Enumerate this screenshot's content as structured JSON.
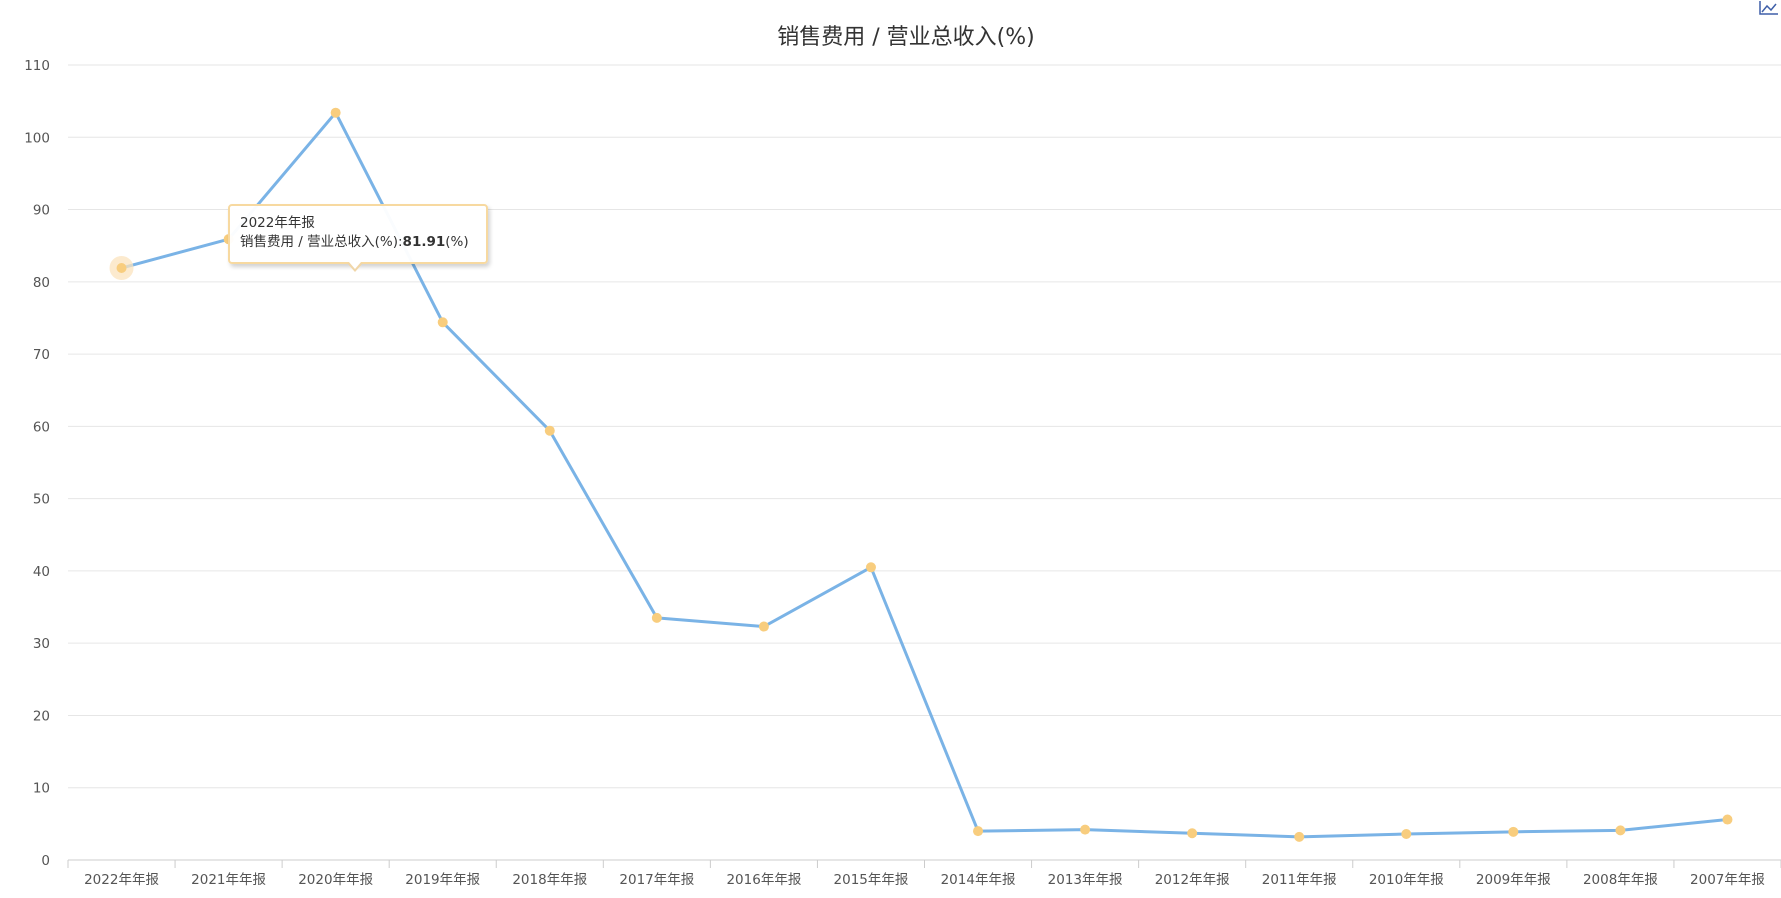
{
  "chart_data": {
    "type": "line",
    "title": "销售费用 / 营业总收入(%)",
    "xlabel": "",
    "ylabel": "",
    "ylim": [
      0,
      110
    ],
    "yticks": [
      0,
      10,
      20,
      30,
      40,
      50,
      60,
      70,
      80,
      90,
      100,
      110
    ],
    "grid": true,
    "categories": [
      "2022年年报",
      "2021年年报",
      "2020年年报",
      "2019年年报",
      "2018年年报",
      "2017年年报",
      "2016年年报",
      "2015年年报",
      "2014年年报",
      "2013年年报",
      "2012年年报",
      "2011年年报",
      "2010年年报",
      "2009年年报",
      "2008年年报",
      "2007年年报"
    ],
    "series": [
      {
        "values": [
          81.91,
          85.9,
          103.4,
          74.4,
          59.4,
          33.5,
          32.3,
          40.5,
          4.0,
          4.2,
          3.7,
          3.2,
          3.6,
          3.9,
          4.1,
          5.6
        ]
      }
    ],
    "colors": {
      "line": "#7ab3e6",
      "marker": "#f8cd7e",
      "highlight": "#fbe3bd"
    }
  },
  "tooltip": {
    "category": "2022年年报",
    "label": "销售费用 / 营业总收入(%):",
    "value": "81.91",
    "unit": "(%)"
  },
  "toolbar": {
    "icon": "line-chart-icon"
  }
}
